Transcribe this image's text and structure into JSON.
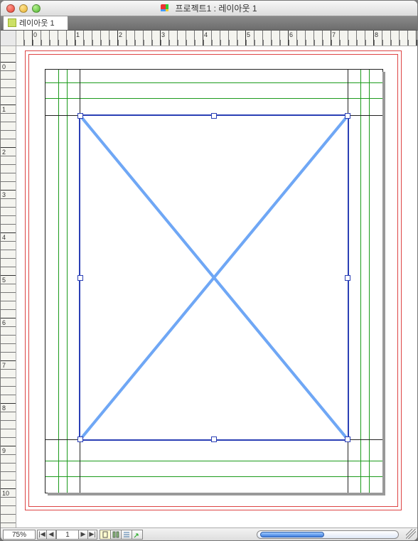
{
  "window": {
    "title": "프로젝트1 : 레이아웃 1",
    "traffic": [
      "close",
      "minimize",
      "zoom"
    ]
  },
  "tab": {
    "label": "레이아웃 1",
    "icon": "layout-icon"
  },
  "ruler": {
    "h_labels": [
      "0",
      "1",
      "2",
      "3",
      "4",
      "5",
      "6",
      "7",
      "8"
    ],
    "v_labels": [
      "0",
      "1",
      "2",
      "3",
      "4",
      "5",
      "6",
      "7",
      "8",
      "9",
      "10"
    ]
  },
  "guides": {
    "bleed_color": "#d44",
    "margin_color": "#1c9b1c",
    "page_border": "#222",
    "box_color": "#2a3fb5"
  },
  "picture_box": {
    "selected": true,
    "kind": "picture"
  },
  "status": {
    "zoom": "75%",
    "page": "1",
    "nav_first": "|◀",
    "nav_prev": "◀",
    "nav_next": "▶",
    "nav_last": "▶|",
    "view_page_icon": "page-view",
    "view_columns_icon": "cols-view",
    "view_story_icon": "story-view",
    "view_arrow_icon": "export-arrow"
  }
}
